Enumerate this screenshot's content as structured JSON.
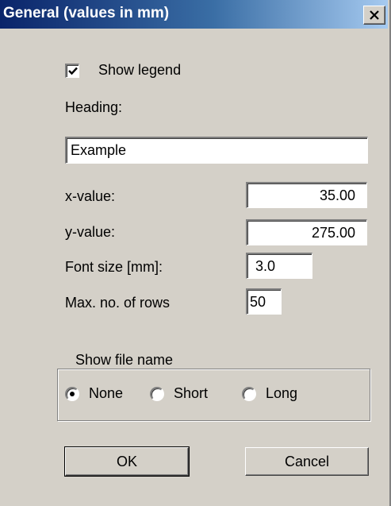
{
  "dialog": {
    "title": "General (values in mm)",
    "close_icon": "close-icon"
  },
  "legend": {
    "show_legend_label": "Show legend",
    "show_legend_checked": true
  },
  "heading": {
    "label": "Heading:",
    "value": "Example"
  },
  "fields": {
    "x_label": "x-value:",
    "x_value": "35.00",
    "y_label": "y-value:",
    "y_value": "275.00",
    "font_size_label": "Font size [mm]:",
    "font_size_value": "3.0",
    "max_rows_label": "Max. no. of rows",
    "max_rows_value": "50"
  },
  "file_name": {
    "group_label": "Show file name",
    "options": [
      "None",
      "Short",
      "Long"
    ],
    "selected": "None"
  },
  "buttons": {
    "ok": "OK",
    "cancel": "Cancel"
  },
  "colors": {
    "titlebar_start": "#0a246a",
    "titlebar_end": "#a6caf0",
    "face": "#d4d0c8"
  }
}
